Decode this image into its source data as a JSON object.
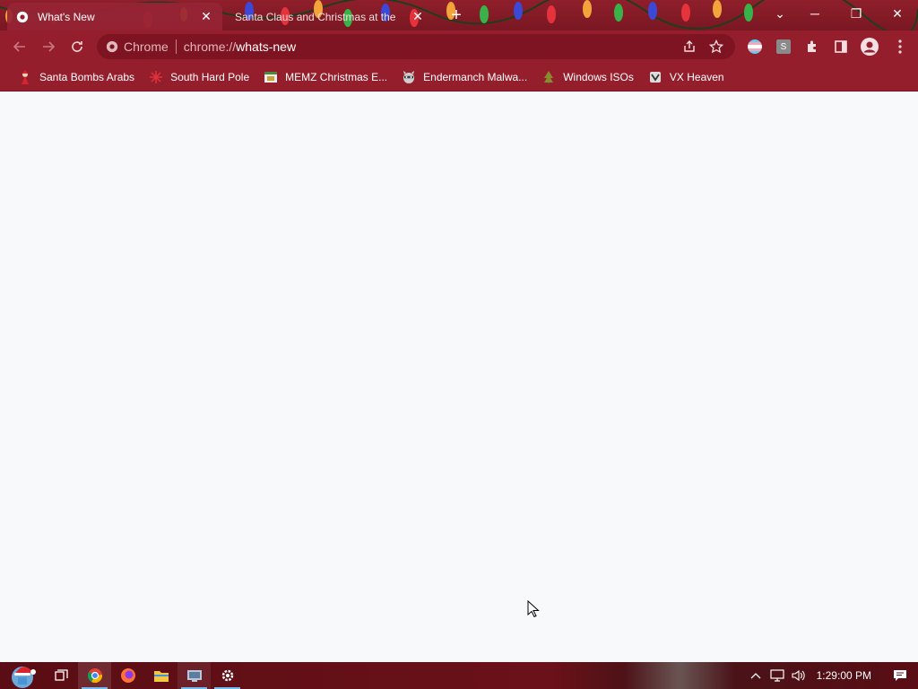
{
  "tabs": [
    {
      "title": "What's New",
      "active": true
    },
    {
      "title": "Santa Claus and Christmas at the",
      "active": false
    }
  ],
  "omnibox": {
    "chip_label": "Chrome",
    "url_scheme": "chrome://",
    "url_host": "whats-new"
  },
  "bookmarks": [
    {
      "label": "Santa Bombs Arabs",
      "icon": "santa-icon"
    },
    {
      "label": "South Hard Pole",
      "icon": "snowflake-icon"
    },
    {
      "label": "MEMZ Christmas E...",
      "icon": "memz-icon"
    },
    {
      "label": "Endermanch Malwa...",
      "icon": "raccoon-icon"
    },
    {
      "label": "Windows ISOs",
      "icon": "tree-icon"
    },
    {
      "label": "VX Heaven",
      "icon": "vx-icon"
    }
  ],
  "extensions": {
    "s_badge": "S"
  },
  "taskbar": {
    "clock": "1:29:00 PM",
    "apps": [
      "start-orb",
      "task-view",
      "chrome",
      "firefox",
      "file-explorer",
      "network-app",
      "settings"
    ]
  },
  "colors": {
    "frame": "#951e2c",
    "tabstrip": "#8e1f2b",
    "omnibox": "#7e1421",
    "page": "#f8f9fb",
    "taskbar": "#5a0d14"
  }
}
